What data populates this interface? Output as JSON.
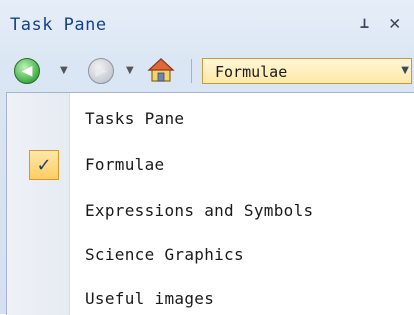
{
  "pane": {
    "title": "Task Pane",
    "pin_icon": "pin-icon",
    "close_icon": "close-icon"
  },
  "toolbar": {
    "back_icon": "back-arrow-icon",
    "forward_icon": "forward-arrow-icon",
    "home_icon": "home-icon",
    "selected": "Formulae"
  },
  "menu": {
    "items": [
      {
        "label": "Tasks Pane",
        "checked": false
      },
      {
        "label": "Formulae",
        "checked": true
      },
      {
        "label": "Expressions and Symbols",
        "checked": false
      },
      {
        "label": "Science Graphics",
        "checked": false
      },
      {
        "label": "Useful images",
        "checked": false
      }
    ],
    "check_glyph": "✓"
  },
  "colors": {
    "title_text": "#15428b",
    "highlight_bg": "#ffe9a6",
    "highlight_border": "#c79a3c",
    "pane_bg": "#dbe6f4"
  }
}
